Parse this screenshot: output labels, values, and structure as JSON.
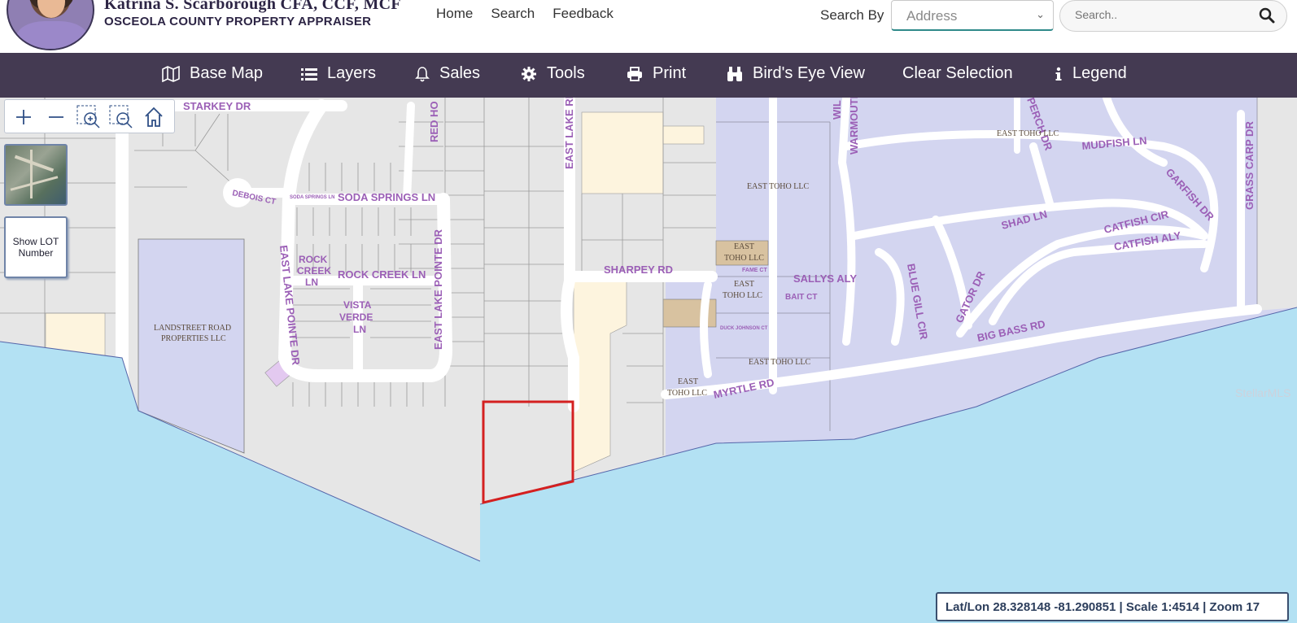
{
  "header": {
    "appraiser_name": "Katrina S. Scarborough CFA, CCF, MCF",
    "office_name": "OSCEOLA COUNTY PROPERTY APPRAISER",
    "nav": [
      "Home",
      "Search",
      "Feedback"
    ],
    "search_by_label": "Search By",
    "search_by_value": "Address",
    "search_placeholder": "Search.."
  },
  "toolbar": {
    "items": [
      "Base Map",
      "Layers",
      "Sales",
      "Tools",
      "Print",
      "Bird's Eye View",
      "Clear Selection",
      "Legend"
    ]
  },
  "map": {
    "show_lot_label": "Show LOT Number",
    "coords_readout": "Lat/Lon 28.328148 -81.290851 | Scale 1:4514 | Zoom 17",
    "watermark": "StellarMLS",
    "streets": [
      "STARKEY DR",
      "RED HO",
      "DEBOIS CT",
      "SODA SPRINGS LN",
      "SODA SPRINGS LN",
      "EAST LAKE POINTE DR",
      "ROCK CREEK LN",
      "ROCK CREEK LN",
      "VISTA VERDE LN",
      "EAST LAKE POINTE DR",
      "EAST LAKE RD",
      "SHARPEY RD",
      "SALLYS ALY",
      "BAIT CT",
      "FAME CT",
      "DUCK JOHNSON CT",
      "MYRTLE RD",
      "BLUE GILL CIR",
      "GATOR DR",
      "BIG BASS RD",
      "SHAD LN",
      "CATFISH CIR",
      "CATFISH ALY",
      "MUDFISH LN",
      "GARFISH DR",
      "GRASS CARP DR",
      "WARMOUTH",
      "PERCH DR",
      "WIL"
    ],
    "owners": [
      "LANDSTREET ROAD PROPERTIES LLC",
      "EAST TOHO LLC",
      "EAST TOHO LLC",
      "EAST TOHO LLC",
      "EAST TOHO LLC",
      "EAST TOHO LLC",
      "EAST TOHO LLC"
    ]
  },
  "colors": {
    "toolbar_bg": "#443a52",
    "water": "#b3e1f3",
    "parcel_gray": "#e5e5e5",
    "parcel_lavender": "#d4d6f0",
    "parcel_cream": "#fdf4de",
    "parcel_tan": "#d8c2a0",
    "selection": "#d42020",
    "street_label": "#9b5fb6"
  }
}
